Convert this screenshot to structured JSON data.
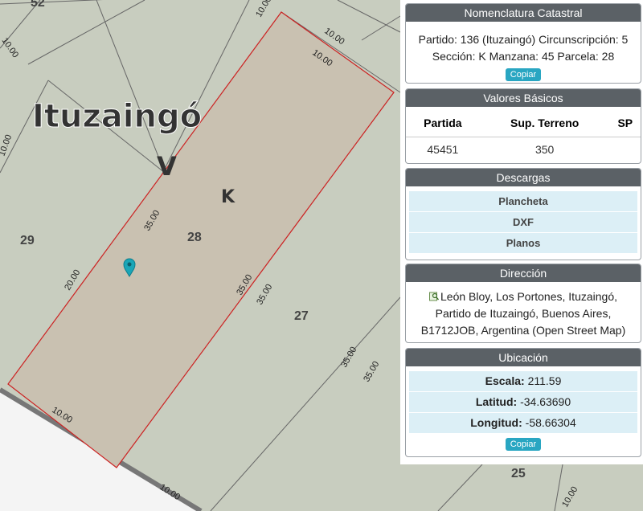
{
  "map": {
    "locality_label": "Ituzaingó",
    "circ_label": "V",
    "section_label": "K",
    "lots": {
      "l52": "52",
      "l29": "29",
      "l28": "28",
      "l27": "27",
      "l25": "25"
    },
    "dims": {
      "d1": "10.00",
      "d2": "10.00",
      "d3": "10.00",
      "d4": "35.00",
      "d5": "20.00",
      "d6": "35.00",
      "d7": "35.00",
      "d8": "35.00",
      "d9": "10.00",
      "d10": "10.00",
      "d11": "10.00",
      "d12": "10.00",
      "d13": "10.00"
    },
    "marker_color": "#1aa6b7",
    "highlight_color": "#c9c1b1",
    "boundary_color": "#cc2222"
  },
  "panel": {
    "nomenclatura": {
      "title": "Nomenclatura Catastral",
      "line1": "Partido: 136 (Ituzaingó) Circunscripción: 5",
      "line2": "Sección: K Manzana: 45 Parcela: 28",
      "copy_label": "Copiar"
    },
    "valores": {
      "title": "Valores Básicos",
      "headers": [
        "Partida",
        "Sup. Terreno",
        "SP"
      ],
      "row": [
        "45451",
        "350",
        ""
      ]
    },
    "descargas": {
      "title": "Descargas",
      "items": [
        "Plancheta",
        "DXF",
        "Planos"
      ]
    },
    "direccion": {
      "title": "Dirección",
      "line1": "León Bloy, Los Portones, Ituzaingó,",
      "line2": "Partido de Ituzaingó, Buenos Aires,",
      "line3": "B1712JOB, Argentina (Open Street Map)"
    },
    "ubicacion": {
      "title": "Ubicación",
      "escala_label": "Escala:",
      "escala_value": "211.59",
      "latitud_label": "Latitud:",
      "latitud_value": "-34.63690",
      "longitud_label": "Longitud:",
      "longitud_value": "-58.66304",
      "copy_label": "Copiar"
    }
  }
}
